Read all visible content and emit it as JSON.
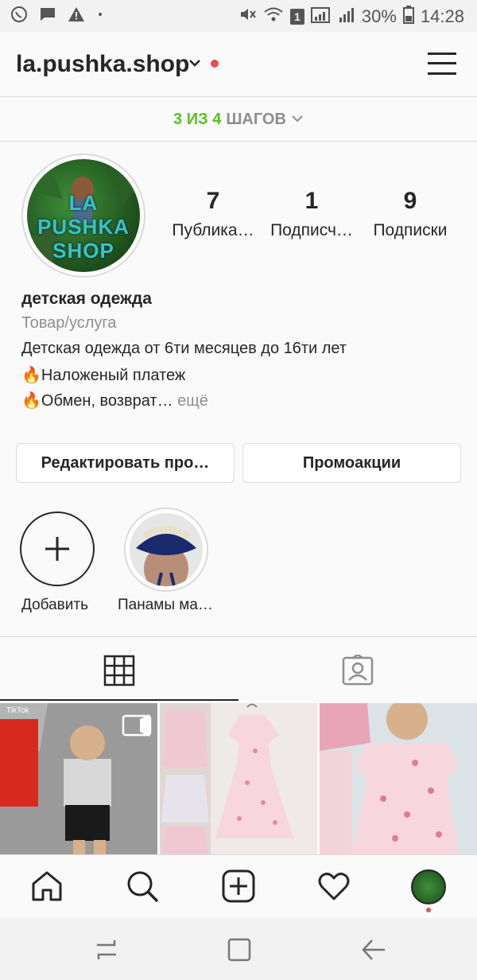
{
  "status_bar": {
    "battery_percent": "30%",
    "time": "14:28",
    "sim_badge": "1"
  },
  "header": {
    "username": "la.pushka.shop"
  },
  "steps": {
    "progress": "3 ИЗ 4",
    "label": "ШАГОВ"
  },
  "profile": {
    "avatar_text": [
      "LA",
      "PUSHKA",
      "SHOP"
    ],
    "stats": [
      {
        "count": "7",
        "label": "Публика…"
      },
      {
        "count": "1",
        "label": "Подписч…"
      },
      {
        "count": "9",
        "label": "Подписки"
      }
    ],
    "name": "детская одежда",
    "category": "Товар/услуга",
    "bio_lines": [
      "Детская одежда от 6ти месяцев до 16ти лет",
      "Наложеный платеж",
      "Обмен, возврат…"
    ],
    "more": "ещё"
  },
  "buttons": {
    "edit_profile": "Редактировать про…",
    "promotions": "Промоакции"
  },
  "highlights": [
    {
      "label": "Добавить"
    },
    {
      "label": "Панамы ма…"
    }
  ],
  "posts": {
    "tiktok_label": "TikTok"
  },
  "colors": {
    "accent_green": "#58c322",
    "notification_red": "#ed4956",
    "text_primary": "#262626",
    "text_secondary": "#8e8e8e"
  }
}
